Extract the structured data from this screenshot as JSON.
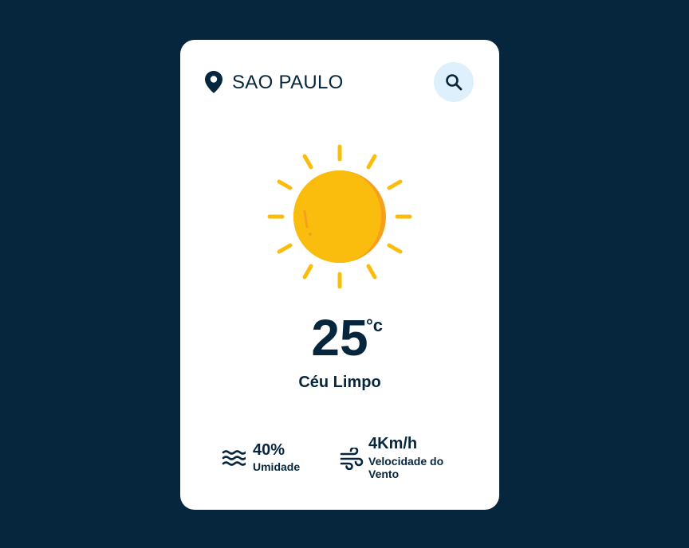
{
  "location": {
    "city": "SAO PAULO",
    "pin_icon": "location-pin-icon"
  },
  "search": {
    "icon": "search-icon"
  },
  "weather": {
    "icon": "sun-icon",
    "temperature": "25",
    "unit": "°c",
    "description": "Céu Limpo"
  },
  "details": {
    "humidity": {
      "icon": "waves-icon",
      "value": "40%",
      "label": "Umidade"
    },
    "wind": {
      "icon": "wind-icon",
      "value": "4Km/h",
      "label": "Velocidade do Vento"
    }
  },
  "colors": {
    "background": "#06263d",
    "card": "#ffffff",
    "accent_light": "#ddf0fb",
    "sun_yellow": "#fbbd0d",
    "sun_orange": "#f6a01e",
    "text": "#06263d"
  }
}
